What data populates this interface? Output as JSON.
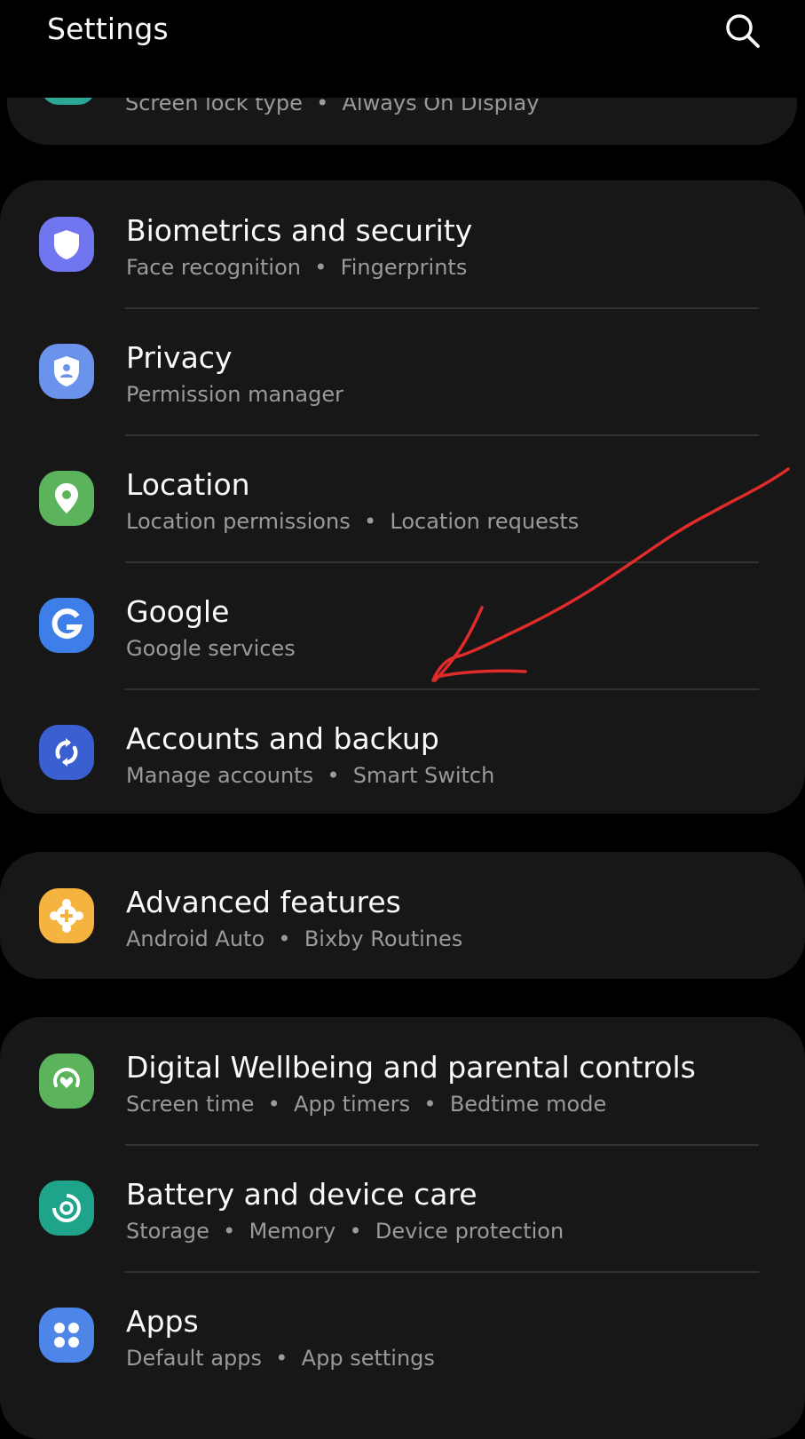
{
  "header": {
    "title": "Settings",
    "search_icon": "search-icon"
  },
  "partial_item": {
    "subtitle_parts": [
      "Screen lock type",
      "Always On Display"
    ]
  },
  "groups": [
    {
      "items": [
        {
          "title": "Biometrics and security",
          "subtitle_parts": [
            "Face recognition",
            "Fingerprints"
          ],
          "icon": "shield-icon",
          "color": "#7075f0"
        },
        {
          "title": "Privacy",
          "subtitle_parts": [
            "Permission manager"
          ],
          "icon": "privacy-shield-icon",
          "color": "#6b93eb"
        },
        {
          "title": "Location",
          "subtitle_parts": [
            "Location permissions",
            "Location requests"
          ],
          "icon": "location-pin-icon",
          "color": "#5bb35b"
        },
        {
          "title": "Google",
          "subtitle_parts": [
            "Google services"
          ],
          "icon": "google-g-icon",
          "color": "#3e7ee8"
        },
        {
          "title": "Accounts and backup",
          "subtitle_parts": [
            "Manage accounts",
            "Smart Switch"
          ],
          "icon": "sync-arrows-icon",
          "color": "#3a5fd0"
        }
      ]
    },
    {
      "items": [
        {
          "title": "Advanced features",
          "subtitle_parts": [
            "Android Auto",
            "Bixby Routines"
          ],
          "icon": "gear-plus-icon",
          "color": "#f5b33f"
        }
      ]
    },
    {
      "items": [
        {
          "title": "Digital Wellbeing and parental controls",
          "subtitle_parts": [
            "Screen time",
            "App timers",
            "Bedtime mode"
          ],
          "icon": "wellbeing-heart-icon",
          "color": "#5bb35b"
        },
        {
          "title": "Battery and device care",
          "subtitle_parts": [
            "Storage",
            "Memory",
            "Device protection"
          ],
          "icon": "device-care-icon",
          "color": "#1fa48c"
        },
        {
          "title": "Apps",
          "subtitle_parts": [
            "Default apps",
            "App settings"
          ],
          "icon": "apps-grid-icon",
          "color": "#4d86e8"
        }
      ]
    }
  ],
  "annotation": {
    "type": "hand-drawn-arrow",
    "color": "#e02b2b",
    "points_to": "Google"
  }
}
